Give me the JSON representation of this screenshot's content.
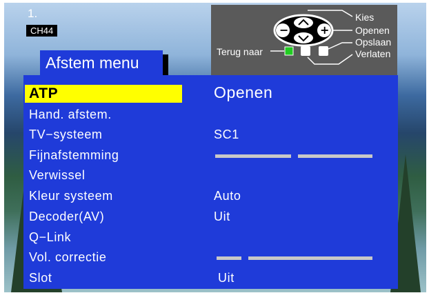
{
  "osd": {
    "channel_number": "1.",
    "channel_name": "CH44"
  },
  "legend": {
    "labels": [
      "Kies",
      "Openen",
      "Opslaan",
      "Verlaten"
    ],
    "back_label": "Terug naar",
    "colors": {
      "green": "#22cc22",
      "white": "#ffffff",
      "panel": "#5a5a5a"
    },
    "minus_symbol": "−",
    "plus_symbol": "+"
  },
  "menu": {
    "title": "Afstem menu",
    "items": [
      {
        "label": "ATP",
        "value": "Openen",
        "selected": true
      },
      {
        "label": "Hand. afstem.",
        "value": ""
      },
      {
        "label": "TV−systeem",
        "value": "SC1"
      },
      {
        "label": "Fijnafstemming",
        "value": "",
        "control": "slider"
      },
      {
        "label": "Verwissel",
        "value": ""
      },
      {
        "label": "Kleur systeem",
        "value": "Auto"
      },
      {
        "label": "Decoder(AV)",
        "value": "Uit"
      },
      {
        "label": "Q−Link",
        "value": ""
      },
      {
        "label": "Vol. correctie",
        "value": "",
        "control": "slider"
      },
      {
        "label": "Slot",
        "value": "Uit"
      }
    ],
    "colors": {
      "background": "#1f3bd9",
      "highlight": "#ffff00",
      "text": "#ffffff",
      "bar": "#c8c8c8"
    }
  }
}
